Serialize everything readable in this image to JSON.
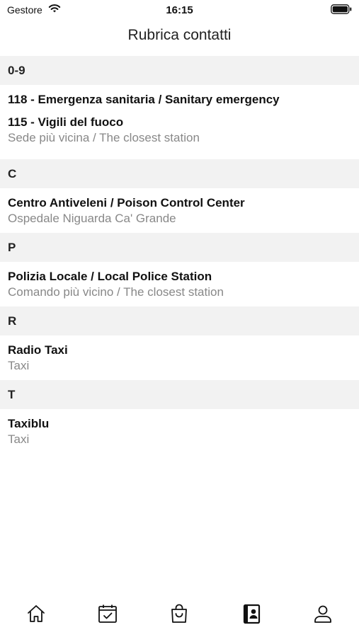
{
  "status": {
    "carrier": "Gestore",
    "time": "16:15"
  },
  "nav": {
    "title": "Rubrica contatti"
  },
  "sections": [
    {
      "header": "0-9",
      "items": [
        {
          "title": "118 - Emergenza sanitaria / Sanitary emergency",
          "subtitle": ""
        },
        {
          "title": "115 - Vigili del fuoco",
          "subtitle": "Sede più vicina / The closest station"
        }
      ]
    },
    {
      "header": "C",
      "items": [
        {
          "title": "Centro Antiveleni / Poison Control Center",
          "subtitle": "Ospedale Niguarda Ca' Grande"
        }
      ]
    },
    {
      "header": "P",
      "items": [
        {
          "title": "Polizia Locale / Local Police Station",
          "subtitle": "Comando più vicino / The closest station"
        }
      ]
    },
    {
      "header": "R",
      "items": [
        {
          "title": "Radio Taxi",
          "subtitle": "Taxi"
        }
      ]
    },
    {
      "header": "T",
      "items": [
        {
          "title": "Taxiblu",
          "subtitle": "Taxi"
        }
      ]
    }
  ],
  "tabs": [
    {
      "icon": "home-icon",
      "selected": false
    },
    {
      "icon": "calendar-check-icon",
      "selected": false
    },
    {
      "icon": "shopping-bag-icon",
      "selected": false
    },
    {
      "icon": "address-book-icon",
      "selected": true
    },
    {
      "icon": "user-icon",
      "selected": false
    }
  ]
}
